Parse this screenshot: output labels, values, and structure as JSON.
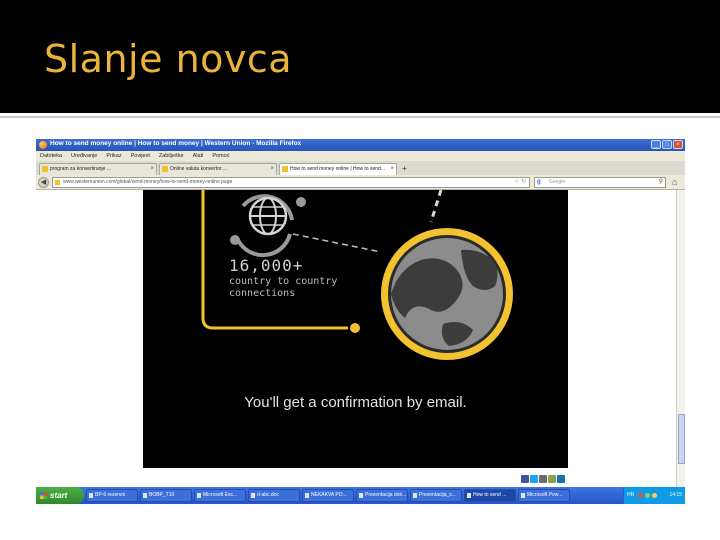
{
  "slide": {
    "title": "Slanje novca"
  },
  "browser": {
    "window_title": "How to send money online | How to send money | Western Union - Mozilla Firefox",
    "window_buttons": [
      "_",
      "□",
      "×"
    ],
    "menu": [
      "Datoteka",
      "Uređivanje",
      "Prikaz",
      "Povijest",
      "Zabilješke",
      "Alati",
      "Pomoć"
    ],
    "tabs": [
      {
        "label": "program za konvertiranje ...",
        "active": false
      },
      {
        "label": "Online valuta konvertor ...",
        "active": false
      },
      {
        "label": "How to send money online | How to send...",
        "active": true
      }
    ],
    "new_tab": "+",
    "url": "www.westernunion.com/global/send-money/how-to-send-money-online.page",
    "search_engine": "g",
    "search_placeholder": "Google"
  },
  "video": {
    "stat": "16,000+",
    "description": "country to country connections",
    "caption": "You'll get a confirmation by email.",
    "accent_color": "#f2c230",
    "globe_land_color": "#8c8c8c"
  },
  "share_buttons": [
    {
      "icon": "facebook-icon",
      "color": "#3b5998"
    },
    {
      "icon": "twitter-icon",
      "color": "#1da1f2"
    },
    {
      "icon": "googleplus-icon",
      "color": "#6b6b6b"
    },
    {
      "icon": "email-icon",
      "color": "#8aa04a"
    },
    {
      "icon": "linkedin-icon",
      "color": "#0e76a8"
    }
  ],
  "taskbar": {
    "start_label": "start",
    "tasks": [
      {
        "label": "BP-6 rezervni",
        "active": false
      },
      {
        "label": "BOBP_T10",
        "active": false
      },
      {
        "label": "Microsoft Exc...",
        "active": false
      },
      {
        "label": "d-abc.doc",
        "active": false
      },
      {
        "label": "NEKAKVA PO...",
        "active": false
      },
      {
        "label": "Prezentacija dok...",
        "active": false
      },
      {
        "label": "Prezentacija_s...",
        "active": false
      },
      {
        "label": "How to send ...",
        "active": true
      },
      {
        "label": "Microsoft Pow...",
        "active": false
      }
    ],
    "tray_lang": "HR",
    "clock": "14:15"
  }
}
